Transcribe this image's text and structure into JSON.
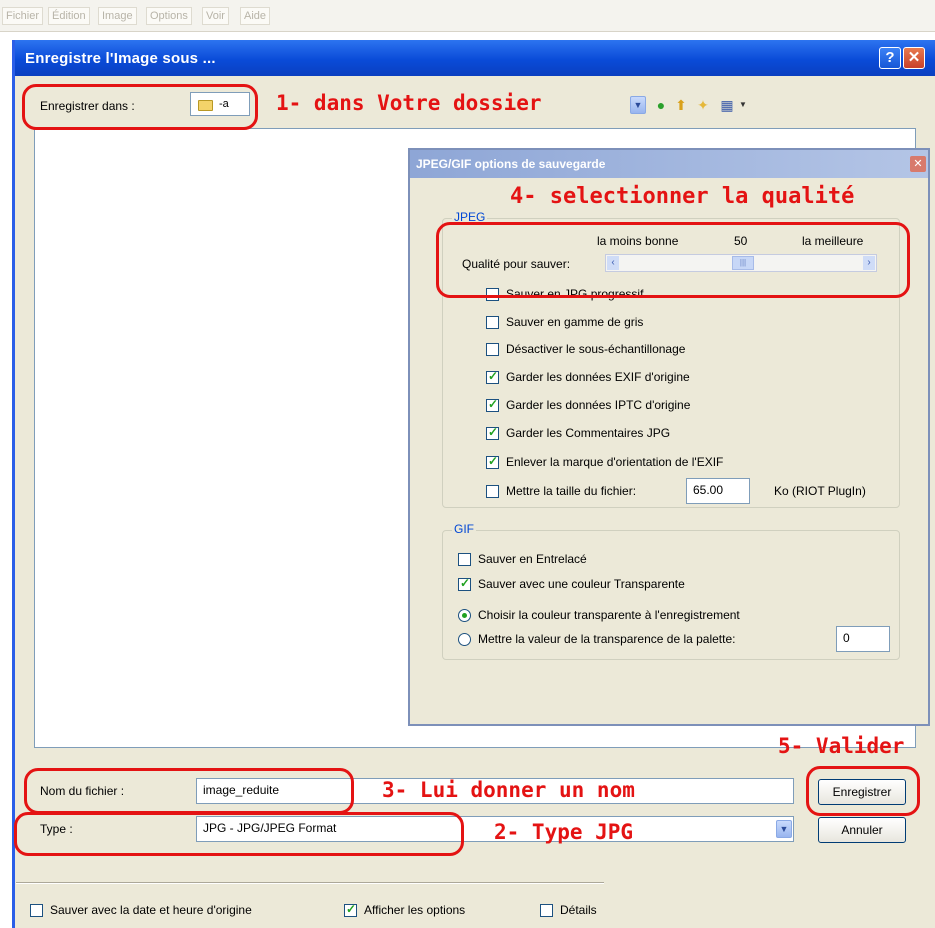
{
  "app_menu": {
    "items": [
      "Fichier",
      "Édition",
      "Image",
      "Options",
      "Voir",
      "Aide"
    ]
  },
  "dialog": {
    "title": "Enregistre l'Image sous ...",
    "help_glyph": "?",
    "close_glyph": "✕",
    "save_in_label": "Enregistrer dans :",
    "save_in_value": "-a",
    "filename_label": "Nom du fichier :",
    "filename_value": "image_reduite",
    "type_label": "Type :",
    "type_value": "JPG - JPG/JPEG Format",
    "save_button": "Enregistrer",
    "cancel_button": "Annuler",
    "footer": {
      "keep_date_label": "Sauver avec la date et heure d'origine",
      "keep_date_checked": false,
      "show_options_label": "Afficher les options",
      "show_options_checked": true,
      "details_label": "Détails",
      "details_checked": false
    }
  },
  "options_dialog": {
    "title": "JPEG/GIF options de sauvegarde",
    "jpeg": {
      "group_label": "JPEG",
      "quality_min_label": "la moins bonne",
      "quality_value": "50",
      "quality_max_label": "la meilleure",
      "quality_label": "Qualité pour sauver:",
      "slider_left": "‹",
      "slider_right": "›",
      "slider_grip": "|||",
      "options": [
        {
          "label": "Sauver en JPG progressif",
          "checked": false
        },
        {
          "label": "Sauver en gamme de gris",
          "checked": false
        },
        {
          "label": "Désactiver le sous-échantillonage",
          "checked": false
        },
        {
          "label": "Garder les données EXIF d'origine",
          "checked": true
        },
        {
          "label": "Garder les données IPTC d'origine",
          "checked": true
        },
        {
          "label": "Garder les Commentaires JPG",
          "checked": true
        },
        {
          "label": "Enlever la marque d'orientation de l'EXIF",
          "checked": true
        },
        {
          "label": "Mettre la taille du fichier:",
          "checked": false
        }
      ],
      "file_size_value": "65.00",
      "file_size_unit": "Ko (RIOT PlugIn)"
    },
    "gif": {
      "group_label": "GIF",
      "interlaced_label": "Sauver en Entrelacé",
      "interlaced_checked": false,
      "transparent_label": "Sauver avec une couleur Transparente",
      "transparent_checked": true,
      "choose_on_save_label": "Choisir la couleur transparente à l'enregistrement",
      "palette_value_label": "Mettre la valeur de la transparence de la palette:",
      "palette_value": "0",
      "selected_radio": "choose_on_save"
    }
  },
  "annotations": {
    "step1": "1- dans Votre dossier",
    "step2": "2- Type JPG",
    "step3": "3- Lui donner un nom",
    "step4": "4- selectionner la qualité",
    "step5": "5- Valider",
    "color": "#e41313"
  },
  "colors": {
    "title_bar": "#0a4bd8",
    "dialog_bg": "#ece9d8",
    "check_mark": "#21a121"
  }
}
